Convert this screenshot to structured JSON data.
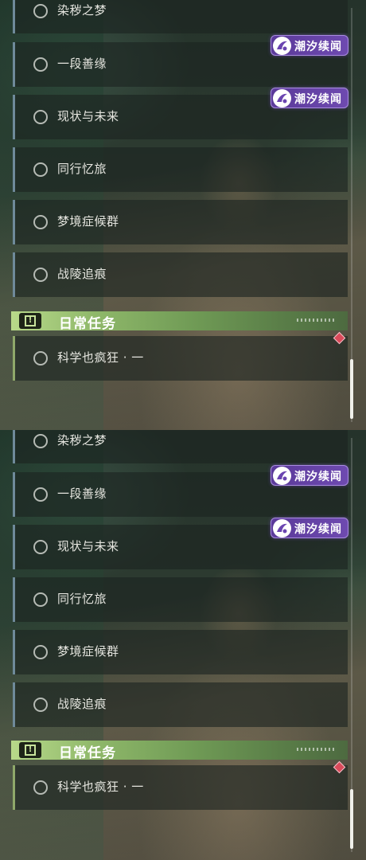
{
  "quest_list": {
    "quests": [
      {
        "label": "染秽之梦"
      },
      {
        "label": "一段善缘",
        "tag": "潮汐续闻"
      },
      {
        "label": "现状与未来",
        "tag": "潮汐续闻"
      },
      {
        "label": "同行忆旅"
      },
      {
        "label": "梦境症候群"
      },
      {
        "label": "战陵追痕"
      }
    ],
    "daily_section": {
      "title": "日常任务",
      "icon": "exclamation-box-icon",
      "quests": [
        {
          "label": "科学也疯狂 · 一"
        }
      ]
    },
    "colors": {
      "tag_bg": "#6e4ab0",
      "daily_header": "#8fb86a",
      "alert_diamond": "#d94a5a",
      "row_accent": "#6f8a9a"
    }
  }
}
